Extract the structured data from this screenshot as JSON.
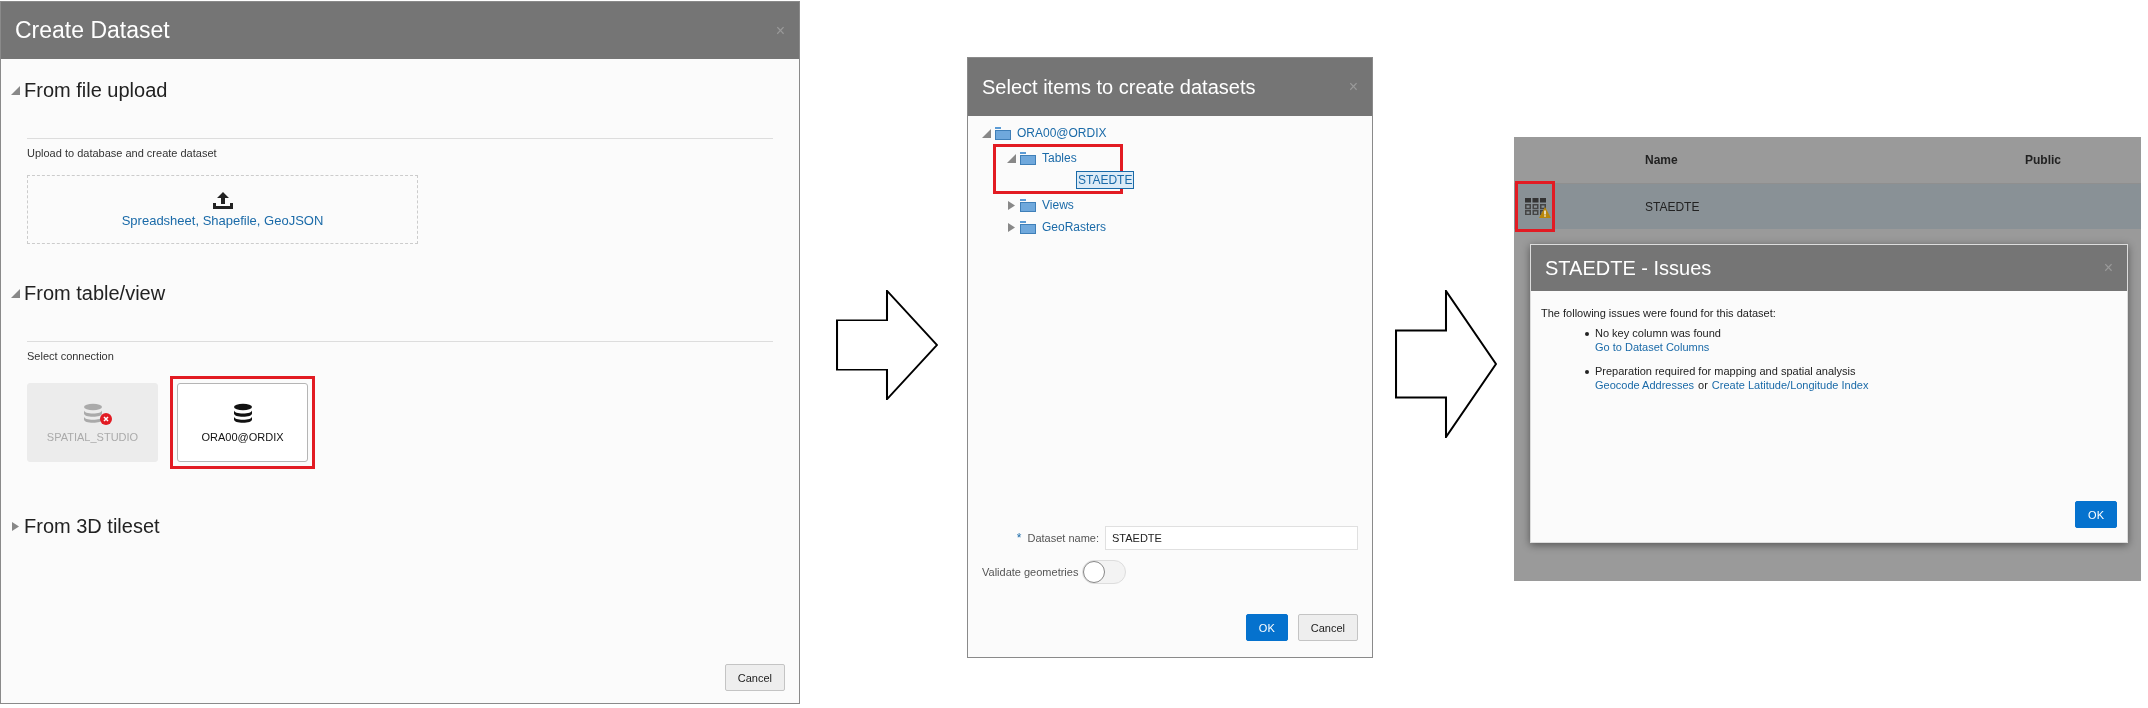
{
  "create_dataset_dialog": {
    "title": "Create Dataset",
    "close": "×",
    "sections": [
      {
        "kind": "upload",
        "title": "From file upload",
        "expanded": true,
        "hint": "Upload to database and create dataset",
        "upload_link": "Spreadsheet, Shapefile, GeoJSON"
      },
      {
        "kind": "connections",
        "title": "From table/view",
        "expanded": true,
        "hint": "Select connection",
        "connections": [
          {
            "name": "SPATIAL_STUDIO",
            "disabled": true,
            "highlighted": false
          },
          {
            "name": "ORA00@ORDIX",
            "disabled": false,
            "highlighted": true
          }
        ]
      },
      {
        "title": "From 3D tileset",
        "expanded": false
      }
    ],
    "buttons": [
      "Cancel"
    ]
  },
  "select_items_dialog": {
    "title": "Select items to create datasets",
    "close": "×",
    "tree": [
      {
        "label": "ORA00@ORDIX",
        "kind": "folder",
        "expanded": true,
        "selected": false,
        "children": [
          {
            "label": "Tables",
            "kind": "folder",
            "expanded": true,
            "selected": false,
            "highlighted": true,
            "children": [
              {
                "label": "STAEDTE",
                "kind": "table",
                "selected": true
              }
            ]
          },
          {
            "label": "Views",
            "kind": "folder",
            "expanded": false,
            "selected": false
          },
          {
            "label": "GeoRasters",
            "kind": "folder",
            "expanded": false,
            "selected": false
          }
        ]
      }
    ],
    "dataset_name": {
      "required_mark": "*",
      "label": "Dataset name:",
      "value": "STAEDTE"
    },
    "validate": {
      "label": "Validate geometries",
      "on": false
    },
    "buttons": [
      {
        "label": "OK",
        "kind": "primary"
      },
      {
        "label": "Cancel",
        "kind": "secondary"
      }
    ]
  },
  "datasets_view": {
    "table": {
      "columns": [
        "Name",
        "Public"
      ],
      "rows": [
        {
          "name": "STAEDTE",
          "warning": true,
          "highlighted": true
        }
      ]
    },
    "issues_dialog": {
      "title": "STAEDTE - Issues",
      "close": "×",
      "intro": "The following issues were found for this dataset:",
      "issues": [
        {
          "text": "No key column was found",
          "actions": [
            {
              "kind": "link",
              "text": "Go to Dataset Columns"
            }
          ]
        },
        {
          "text": "Preparation required for mapping and spatial analysis",
          "actions": [
            {
              "kind": "link",
              "text": "Geocode Addresses"
            },
            {
              "kind": "text",
              "text": "or"
            },
            {
              "kind": "link",
              "text": "Create Latitude/Longitude Index"
            }
          ]
        }
      ],
      "buttons": [
        "OK"
      ]
    }
  }
}
